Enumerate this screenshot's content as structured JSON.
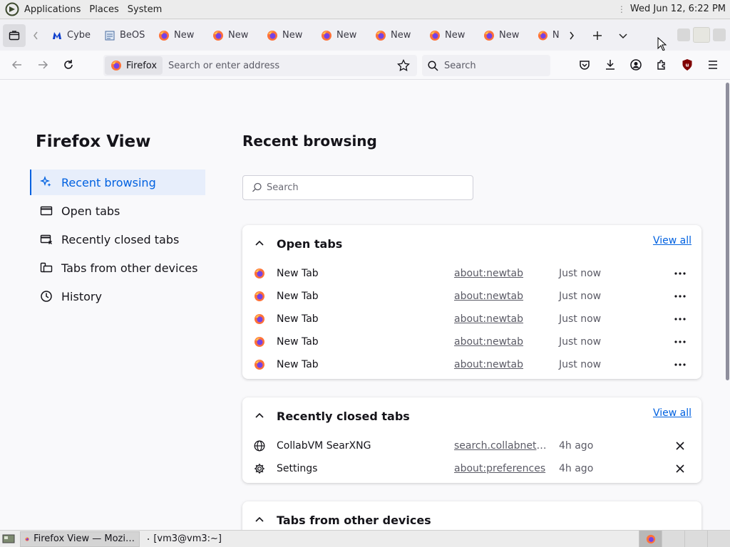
{
  "system_panel": {
    "menu": [
      "Applications",
      "Places",
      "System"
    ],
    "clock": "Wed Jun 12,  6:22 PM"
  },
  "tabstrip": {
    "tabs": [
      {
        "label": "Cybe",
        "icon": "malwarebytes-icon"
      },
      {
        "label": "BeOS",
        "icon": "page-icon"
      },
      {
        "label": "New",
        "icon": "firefox-icon"
      },
      {
        "label": "New",
        "icon": "firefox-icon"
      },
      {
        "label": "New",
        "icon": "firefox-icon"
      },
      {
        "label": "New",
        "icon": "firefox-icon"
      },
      {
        "label": "New",
        "icon": "firefox-icon"
      },
      {
        "label": "New",
        "icon": "firefox-icon"
      },
      {
        "label": "New",
        "icon": "firefox-icon"
      },
      {
        "label": "N",
        "icon": "firefox-icon"
      }
    ]
  },
  "navbar": {
    "identity_label": "Firefox",
    "url_placeholder": "Search or enter address",
    "search_placeholder": "Search"
  },
  "sidebar": {
    "title": "Firefox View",
    "items": [
      {
        "label": "Recent browsing",
        "icon": "sparkle-icon"
      },
      {
        "label": "Open tabs",
        "icon": "tab-window-icon"
      },
      {
        "label": "Recently closed tabs",
        "icon": "closed-tab-icon"
      },
      {
        "label": "Tabs from other devices",
        "icon": "synced-devices-icon"
      },
      {
        "label": "History",
        "icon": "clock-icon"
      }
    ]
  },
  "main": {
    "title": "Recent browsing",
    "search_placeholder": "Search",
    "open_tabs": {
      "title": "Open tabs",
      "view_all": "View all",
      "rows": [
        {
          "title": "New Tab",
          "url": "about:newtab",
          "time": "Just now"
        },
        {
          "title": "New Tab",
          "url": "about:newtab",
          "time": "Just now"
        },
        {
          "title": "New Tab",
          "url": "about:newtab",
          "time": "Just now"
        },
        {
          "title": "New Tab",
          "url": "about:newtab",
          "time": "Just now"
        },
        {
          "title": "New Tab",
          "url": "about:newtab",
          "time": "Just now"
        }
      ]
    },
    "recently_closed": {
      "title": "Recently closed tabs",
      "view_all": "View all",
      "rows": [
        {
          "title": "CollabVM SearXNG",
          "url": "search.collabnet.…",
          "time": "4h ago"
        },
        {
          "title": "Settings",
          "url": "about:preferences",
          "time": "4h ago"
        }
      ]
    },
    "other_devices": {
      "title": "Tabs from other devices"
    }
  },
  "taskbar": {
    "tasks": [
      {
        "label": "Firefox View — Mozi…"
      },
      {
        "label": "[vm3@vm3:~]"
      }
    ]
  },
  "colors": {
    "accent": "#0061e0",
    "firefox_orange": "#ff7139",
    "firefox_purple": "#7542e5"
  }
}
